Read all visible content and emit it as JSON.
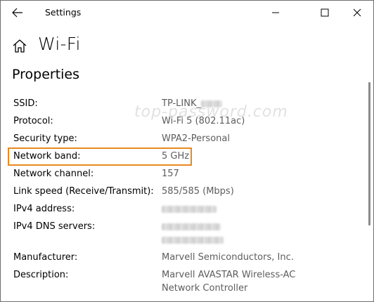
{
  "window": {
    "title": "Settings"
  },
  "header": {
    "page_title": "Wi-Fi",
    "section_title": "Properties"
  },
  "watermark": "top-password.com",
  "properties": {
    "ssid": {
      "label": "SSID:",
      "value": "TP-LINK_"
    },
    "protocol": {
      "label": "Protocol:",
      "value": "Wi-Fi 5 (802.11ac)"
    },
    "security": {
      "label": "Security type:",
      "value": "WPA2-Personal"
    },
    "band": {
      "label": "Network band:",
      "value": "5 GHz"
    },
    "channel": {
      "label": "Network channel:",
      "value": "157"
    },
    "link_speed": {
      "label": "Link speed (Receive/Transmit):",
      "value": "585/585 (Mbps)"
    },
    "ipv4": {
      "label": "IPv4 address:",
      "value": ""
    },
    "dns": {
      "label": "IPv4 DNS servers:",
      "value": ""
    },
    "manufacturer": {
      "label": "Manufacturer:",
      "value": "Marvell Semiconductors, Inc."
    },
    "description": {
      "label": "Description:",
      "value_line1": "Marvell AVASTAR Wireless-AC",
      "value_line2": "Network Controller"
    }
  },
  "icons": {
    "back": "back-arrow-icon",
    "minimize": "minimize-icon",
    "maximize": "maximize-icon",
    "close": "close-icon",
    "home": "home-icon"
  },
  "colors": {
    "highlight": "#e8891f",
    "value_text": "#5d5d5d"
  }
}
